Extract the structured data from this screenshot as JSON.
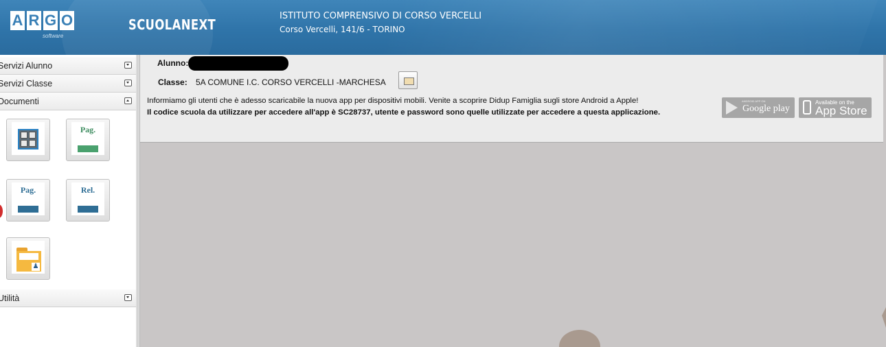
{
  "header": {
    "logo_letters": [
      "A",
      "R",
      "G",
      "O"
    ],
    "logo_sub": "software",
    "product": "SCUOLANEXT",
    "school_name": "ISTITUTO COMPRENSIVO DI CORSO VERCELLI",
    "school_address": "Corso Vercelli, 141/6 - TORINO"
  },
  "sidebar": {
    "sections": [
      {
        "label": "Servizi Alunno",
        "expanded": false
      },
      {
        "label": "Servizi Classe",
        "expanded": false
      },
      {
        "label": "Documenti",
        "expanded": true
      },
      {
        "label": "Utilità",
        "expanded": false
      }
    ],
    "tiles": [
      {
        "icon": "document-grid-icon",
        "text": ""
      },
      {
        "icon": "pagella-icon",
        "text": "Pag."
      },
      {
        "icon": "pagella-icon",
        "text": "Pag."
      },
      {
        "icon": "relazione-icon",
        "text": "Rel."
      },
      {
        "icon": "folder-user-icon",
        "text": ""
      }
    ]
  },
  "info": {
    "alunno_label": "Alunno:",
    "classe_label": "Classe:",
    "classe_value": "5A COMUNE I.C. CORSO VERCELLI -MARCHESA",
    "notice_line1": "Informiamo gli utenti che è adesso scaricabile la nuova app per dispositivi mobili. Venite a scoprire Didup Famiglia sugli store Android a Apple!",
    "notice_line2": "Il codice scuola da utilizzare per accedere all'app è SC28737, utente e password sono quelle utilizzate per accedere a questa applicazione.",
    "google_small": "ANDROID APP ON",
    "google_text": "Google play",
    "apple_small": "Available on the",
    "apple_text": "App Store"
  },
  "colors": {
    "header_blue": "#2f74a9",
    "workspace_gray": "#c9c6c6",
    "panel_gray": "#ececec"
  }
}
